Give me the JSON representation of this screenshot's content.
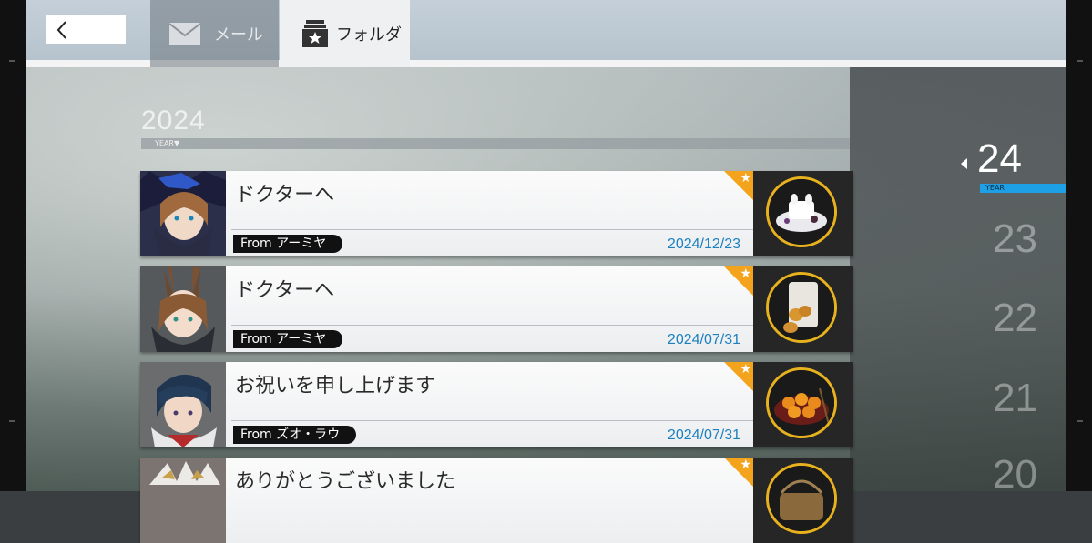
{
  "header": {
    "tabs": [
      {
        "label": "メール",
        "icon": "mail-icon"
      },
      {
        "label": "フォルダ",
        "icon": "folder-star-icon"
      }
    ],
    "back_icon": "chevron-left-icon"
  },
  "section": {
    "year": "2024",
    "sublabel": "YEAR▼"
  },
  "year_nav": {
    "current": "24",
    "current_label": "YEAR",
    "others": [
      "23",
      "22",
      "21",
      "20"
    ]
  },
  "mails": [
    {
      "subject": "ドクターへ",
      "from": "From アーミヤ",
      "date": "2024/12/23",
      "gift": "cake"
    },
    {
      "subject": "ドクターへ",
      "from": "From アーミヤ",
      "date": "2024/07/31",
      "gift": "snack-bag"
    },
    {
      "subject": "お祝いを申し上げます",
      "from": "From ズオ・ラウ",
      "date": "2024/07/31",
      "gift": "pancakes"
    },
    {
      "subject": "ありがとうございました",
      "from": "",
      "date": "",
      "gift": "basket"
    }
  ],
  "colors": {
    "accent": "#1ea0e6",
    "star": "#f3a31c",
    "gift_ring": "#e8b21e",
    "date": "#1c7fbf"
  }
}
